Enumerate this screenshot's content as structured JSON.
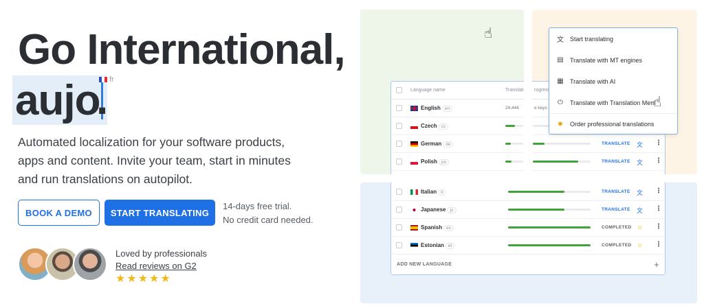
{
  "hero": {
    "line1": "Go International,",
    "typed": "aujo",
    "dot": ".",
    "lang_badge": "fr",
    "subtext": "Automated localization for your software products, apps and content. Invite your team, start in minutes and run translations on autopilot.",
    "book_demo": "BOOK A DEMO",
    "start_translating": "START TRANSLATING",
    "trial_line1": "14-days free trial.",
    "trial_line2": "No credit card needed.",
    "loved": "Loved by professionals",
    "reviews": "Read reviews on G2",
    "stars": "★★★★★"
  },
  "table": {
    "col_language": "Language name",
    "col_translation": "Translatio",
    "col_progress": "rogress",
    "base_keys": "24,444",
    "base_keys2": "e keys",
    "rows": [
      {
        "name": "English",
        "code": "en",
        "flag": "gb"
      },
      {
        "name": "Czech",
        "code": "cs",
        "flag": "cz",
        "p1": 0.55,
        "p2": 0.0
      },
      {
        "name": "German",
        "code": "de",
        "flag": "de",
        "p1": 0.3,
        "p2": 0.2,
        "status": "TRANSLATE"
      },
      {
        "name": "Polish",
        "code": "po",
        "flag": "pl",
        "p1": 0.35,
        "p2": 0.78,
        "status": "TRANSLATE"
      },
      {
        "name": "Italian",
        "code": "it",
        "flag": "it",
        "p": 0.68,
        "status": "TRANSLATE"
      },
      {
        "name": "Japanese",
        "code": "jo",
        "flag": "jp",
        "p": 0.68,
        "status": "TRANSLATE"
      },
      {
        "name": "Spanish",
        "code": "es",
        "flag": "es",
        "p": 1.0,
        "status": "COMPLETED"
      },
      {
        "name": "Estonian",
        "code": "et",
        "flag": "ee",
        "p": 1.0,
        "status": "COMPLETED"
      }
    ],
    "add_language": "ADD NEW LANGUAGE",
    "plus": "+"
  },
  "menu": {
    "items": [
      {
        "label": "Start translating",
        "icon": "translate-icon"
      },
      {
        "label": "Translate with MT engines",
        "icon": "mt-engine-icon"
      },
      {
        "label": "Translate with AI",
        "icon": "ai-chip-icon"
      },
      {
        "label": "Translate with Translation Mem",
        "icon": "plug-icon"
      },
      {
        "label": "Order professional translations",
        "icon": "star-badge-icon"
      }
    ]
  },
  "colors": {
    "primary": "#1f6fe5",
    "progress": "#3fa23a",
    "green_bg": "#eef6e9",
    "orange_bg": "#fdf4e6",
    "blue_bg": "#e8f1fa"
  }
}
